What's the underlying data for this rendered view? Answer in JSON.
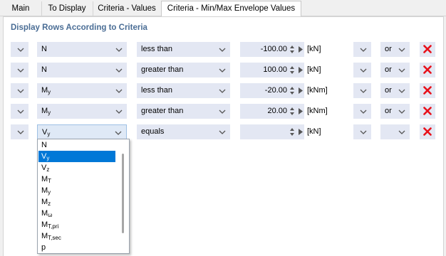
{
  "tabs": [
    {
      "label": "Main",
      "active": false
    },
    {
      "label": "To Display",
      "active": false
    },
    {
      "label": "Criteria - Values",
      "active": false
    },
    {
      "label": "Criteria - Min/Max Envelope Values",
      "active": true
    }
  ],
  "section_title": "Display Rows According to Criteria",
  "rows": [
    {
      "quantity": "N",
      "quantity_sub": "",
      "condition": "less than",
      "value": "-100.00",
      "unit": "[kN]",
      "logic": "or"
    },
    {
      "quantity": "N",
      "quantity_sub": "",
      "condition": "greater than",
      "value": "100.00",
      "unit": "[kN]",
      "logic": "or"
    },
    {
      "quantity": "M",
      "quantity_sub": "y",
      "condition": "less than",
      "value": "-20.00",
      "unit": "[kNm]",
      "logic": "or"
    },
    {
      "quantity": "M",
      "quantity_sub": "y",
      "condition": "greater than",
      "value": "20.00",
      "unit": "[kNm]",
      "logic": "or"
    },
    {
      "quantity": "V",
      "quantity_sub": "y",
      "condition": "equals",
      "value": "",
      "unit": "[kN]",
      "logic": ""
    }
  ],
  "dropdown_options": [
    {
      "main": "N",
      "sub": ""
    },
    {
      "main": "V",
      "sub": "y"
    },
    {
      "main": "V",
      "sub": "z"
    },
    {
      "main": "M",
      "sub": "T"
    },
    {
      "main": "M",
      "sub": "y"
    },
    {
      "main": "M",
      "sub": "z"
    },
    {
      "main": "M",
      "sub": "ω"
    },
    {
      "main": "M",
      "sub": "T,pri"
    },
    {
      "main": "M",
      "sub": "T,sec"
    },
    {
      "main": "p",
      "sub": ""
    }
  ],
  "dropdown_highlighted": "V y",
  "colors": {
    "section_title": "#4a6d95",
    "field_bg": "#e3e7f3",
    "highlight": "#0078d7",
    "delete_icon": "#e8101a"
  },
  "icons": {
    "chevron": "chevron-down-icon",
    "delete": "red-x-delete-icon",
    "spinner": "spinner-updown-icon",
    "play": "play-right-icon"
  }
}
